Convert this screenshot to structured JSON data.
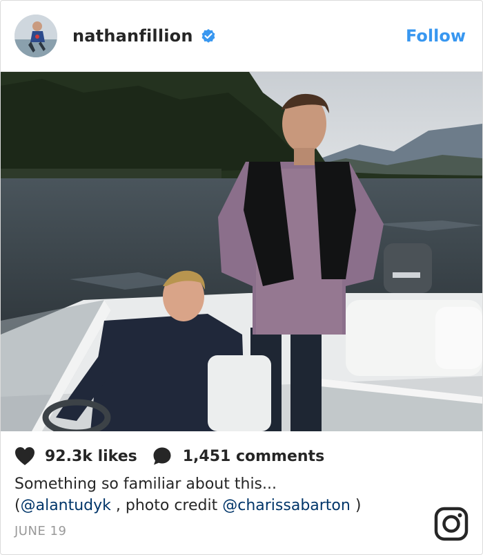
{
  "header": {
    "username": "nathanfillion",
    "follow_label": "Follow"
  },
  "stats": {
    "likes": "92.3k likes",
    "comments": "1,451 comments"
  },
  "caption": {
    "line1": "Something so familiar about this...",
    "open_paren": "(",
    "mention1": "@alantudyk",
    "middle": " , photo credit ",
    "mention2": "@charissabarton",
    "close_paren": " )"
  },
  "date": "JUNE 19",
  "colors": {
    "accent": "#3897f0",
    "mention": "#003569",
    "verified": "#3897f0"
  },
  "icons": [
    "verified-badge-icon",
    "heart-icon",
    "comment-icon",
    "instagram-logo-icon"
  ]
}
